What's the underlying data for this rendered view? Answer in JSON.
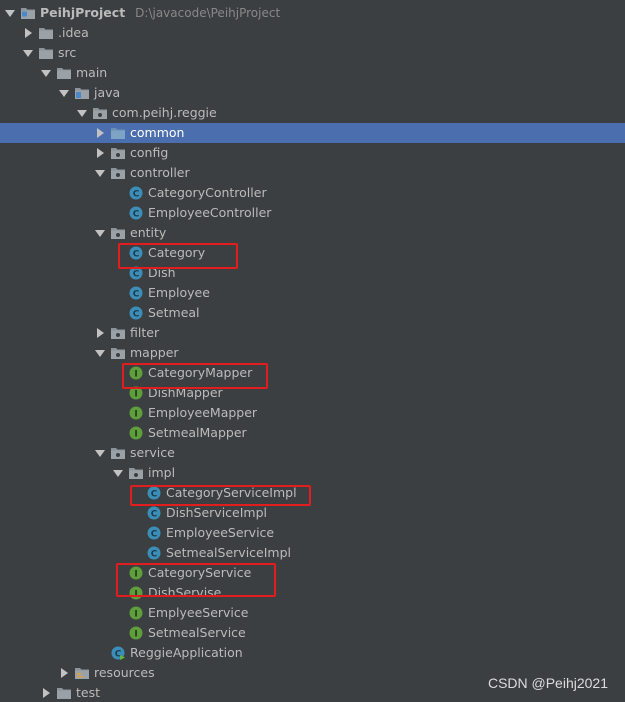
{
  "project": {
    "name": "PeihjProject",
    "path": "D:\\javacode\\PeihjProject"
  },
  "folders": {
    "idea": ".idea",
    "src": "src",
    "main": "main",
    "java": "java",
    "package": "com.peihj.reggie",
    "common": "common",
    "config": "config",
    "controller": "controller",
    "entity": "entity",
    "filter": "filter",
    "mapper": "mapper",
    "service": "service",
    "impl": "impl",
    "resources": "resources",
    "test": "test"
  },
  "files": {
    "category_controller": "CategoryController",
    "employee_controller": "EmployeeController",
    "category": "Category",
    "dish": "Dish",
    "employee": "Employee",
    "setmeal": "Setmeal",
    "category_mapper": "CategoryMapper",
    "dish_mapper": "DishMapper",
    "employee_mapper": "EmployeeMapper",
    "setmeal_mapper": "SetmealMapper",
    "category_service_impl": "CategoryServiceImpl",
    "dish_service_impl": "DishServiceImpl",
    "employee_service": "EmployeeService",
    "setmeal_service_impl": "SetmealServiceImpl",
    "category_service": "CategoryService",
    "dish_servise": "DishServise",
    "emplyee_service": "EmplyeeService",
    "setmeal_service": "SetmealService",
    "reggie_application": "ReggieApplication"
  },
  "selected_item": "common",
  "watermark": "CSDN @Peihj2021",
  "colors": {
    "background": "#3c3f41",
    "selection": "#4b6eaf",
    "highlight_box": "#e11d1d",
    "class_icon": "#3b8eb8",
    "interface_icon": "#5f9e3c",
    "folder_icon": "#8c9399"
  }
}
